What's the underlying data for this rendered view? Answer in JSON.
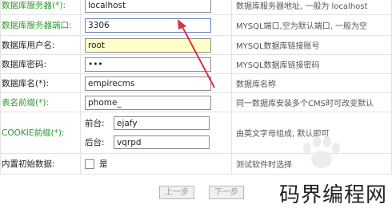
{
  "rows": [
    {
      "label": "数据库服务器(*):",
      "value": "localhost",
      "help": "数据库服务器地址, 一般为 localhost"
    },
    {
      "label": "数据库服务器端口:",
      "value": "3306",
      "help": "MYSQL端口,空为默认端口, 一般为空"
    },
    {
      "label": "数据库用户名:",
      "value": "root",
      "help": "MYSQL数据库链接账号"
    },
    {
      "label": "数据库密码:",
      "value": "•••",
      "help": "MYSQL数据库链接密码"
    },
    {
      "label": "数据库名(*):",
      "value": "empirecms",
      "help": "数据库名称"
    },
    {
      "label": "表名前缀(*):",
      "value": "phome_",
      "help": "同一数据库安装多个CMS时可改变默认"
    },
    {
      "label": "COOKIE前缀(*):",
      "front_label": "前台:",
      "front_value": "ejafy",
      "back_label": "后台:",
      "back_value": "vqrpd",
      "help": "由英文字母组成, 默认即可"
    },
    {
      "label": "内置初始数据:",
      "checkbox_label": "是",
      "help": "测试软件时选择"
    }
  ],
  "buttons": {
    "prev": "上一步",
    "next": "下一步"
  },
  "watermark": "码界编程网",
  "colors": {
    "green_label": "#2e9a2e",
    "arrow": "#d9333f",
    "highlight": "#ffffc8"
  }
}
